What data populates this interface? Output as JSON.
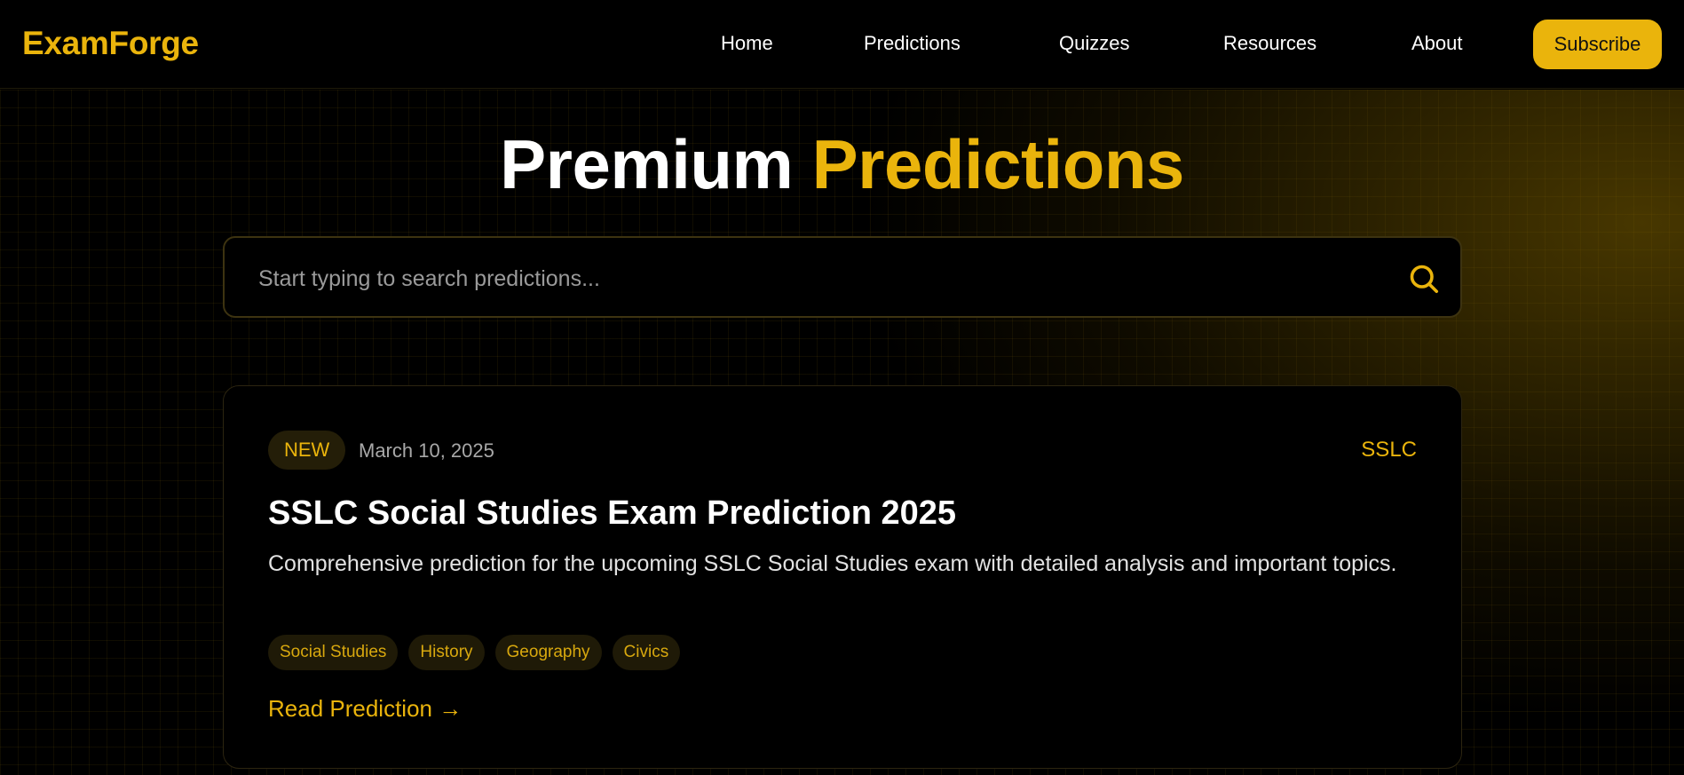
{
  "brand": {
    "name": "ExamForge"
  },
  "nav": {
    "items": [
      {
        "label": "Home"
      },
      {
        "label": "Predictions"
      },
      {
        "label": "Quizzes"
      },
      {
        "label": "Resources"
      },
      {
        "label": "About"
      }
    ],
    "subscribe_label": "Subscribe"
  },
  "hero": {
    "title_main": "Premium",
    "title_accent": "Predictions"
  },
  "search": {
    "placeholder": "Start typing to search predictions...",
    "value": "",
    "icon": "search-icon"
  },
  "card": {
    "badge": "NEW",
    "date": "March 10, 2025",
    "category": "SSLC",
    "title": "SSLC Social Studies Exam Prediction 2025",
    "description": "Comprehensive prediction for the upcoming SSLC Social Studies exam with detailed analysis and important topics.",
    "tags": [
      "Social Studies",
      "History",
      "Geography",
      "Civics"
    ],
    "link_label": "Read Prediction →"
  },
  "colors": {
    "accent": "#eab40c",
    "background": "#000000",
    "text": "#ffffff"
  }
}
